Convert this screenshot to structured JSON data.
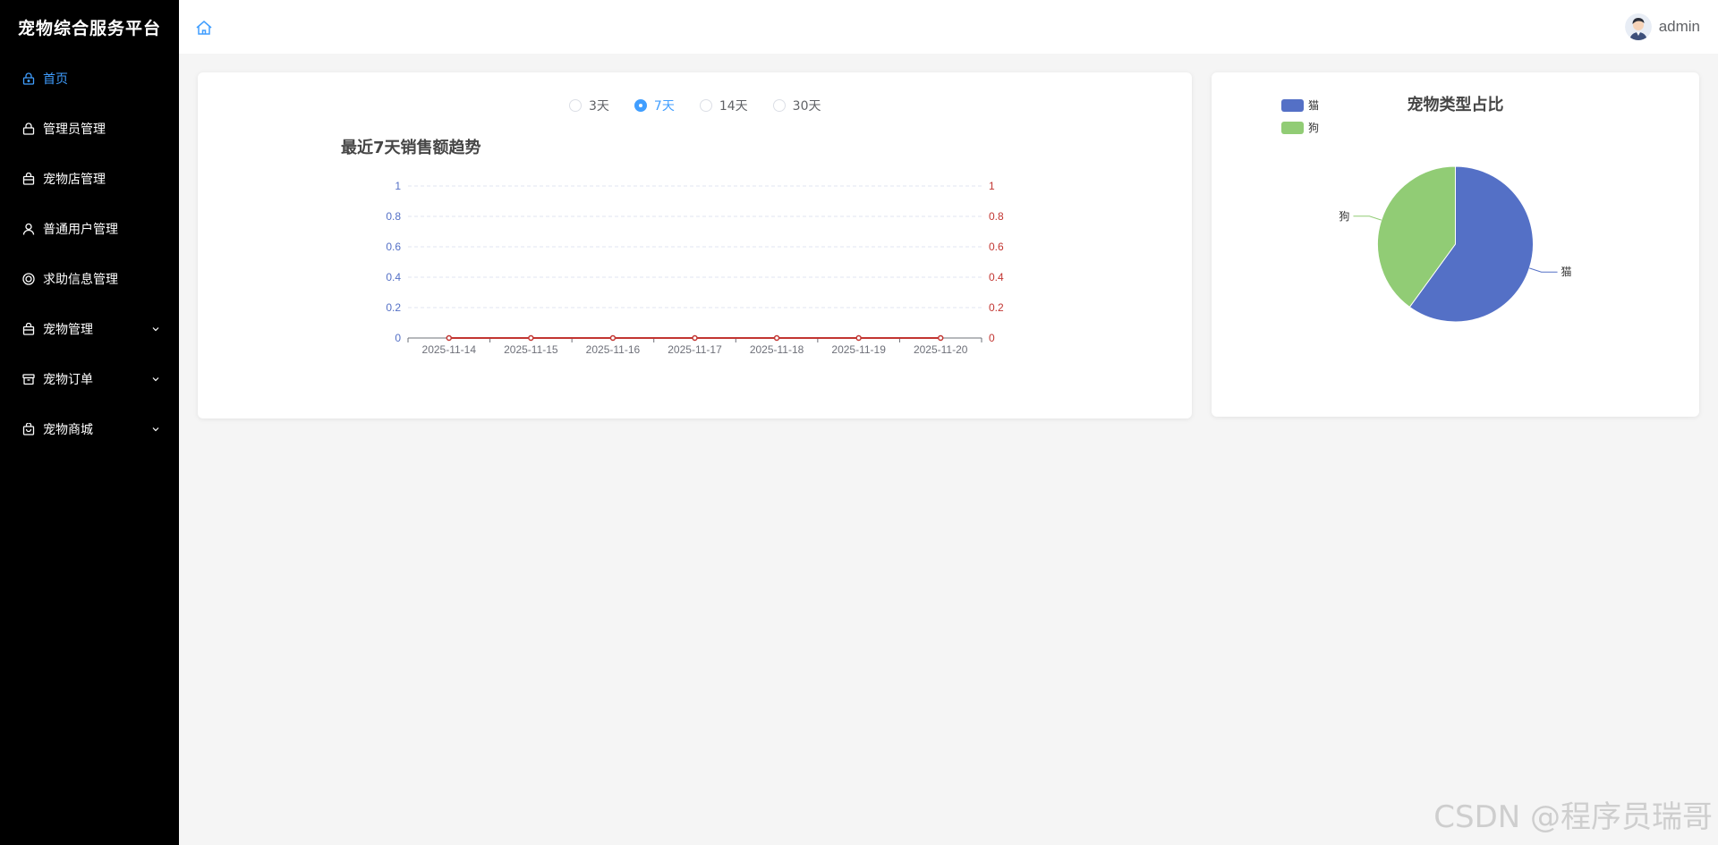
{
  "sidebar": {
    "brand": "宠物综合服务平台",
    "items": [
      {
        "label": "首页",
        "icon": "home-lock-icon",
        "active": true
      },
      {
        "label": "管理员管理",
        "icon": "lock-icon"
      },
      {
        "label": "宠物店管理",
        "icon": "bag-icon"
      },
      {
        "label": "普通用户管理",
        "icon": "user-icon"
      },
      {
        "label": "求助信息管理",
        "icon": "help-icon"
      },
      {
        "label": "宠物管理",
        "icon": "bag-icon",
        "expandable": true
      },
      {
        "label": "宠物订单",
        "icon": "box-icon",
        "expandable": true
      },
      {
        "label": "宠物商城",
        "icon": "shop-icon",
        "expandable": true
      }
    ]
  },
  "header": {
    "username": "admin"
  },
  "range_selector": {
    "options": [
      "3天",
      "7天",
      "14天",
      "30天"
    ],
    "selected": "7天"
  },
  "colors": {
    "accent": "#409eff",
    "left_axis": "#5470c6",
    "right_axis": "#c23531",
    "cat": "#5470c6",
    "dog": "#91cc75"
  },
  "chart_data": [
    {
      "type": "line",
      "title": "最近7天销售额趋势",
      "x": [
        "2025-11-14",
        "2025-11-15",
        "2025-11-16",
        "2025-11-17",
        "2025-11-18",
        "2025-11-19",
        "2025-11-20"
      ],
      "series": [
        {
          "values": [
            0,
            0,
            0,
            0,
            0,
            0,
            0
          ]
        }
      ],
      "ylim": [
        0,
        1
      ],
      "yticks": [
        "0",
        "0.2",
        "0.4",
        "0.6",
        "0.8",
        "1"
      ],
      "y2ticks": [
        "0",
        "0.2",
        "0.4",
        "0.6",
        "0.8",
        "1"
      ],
      "grid": true
    },
    {
      "type": "pie",
      "title": "宠物类型占比",
      "legend": [
        "猫",
        "狗"
      ],
      "slices": [
        {
          "label": "猫",
          "value": 60
        },
        {
          "label": "狗",
          "value": 40
        }
      ],
      "legend_position": "top-left"
    }
  ],
  "watermark": "CSDN @程序员瑞哥"
}
